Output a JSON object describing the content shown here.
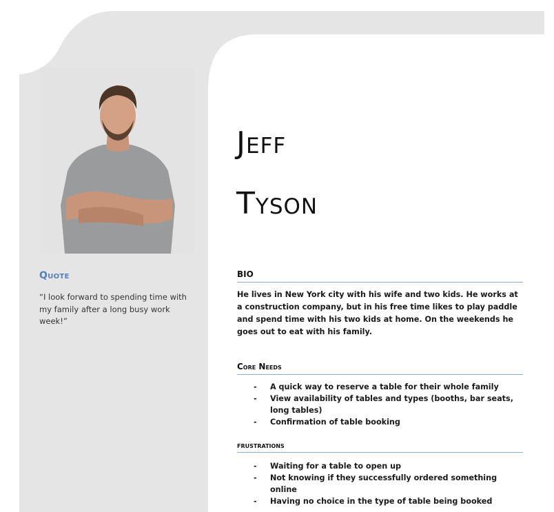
{
  "persona": {
    "first_name": "Jeff",
    "last_name": "Tyson"
  },
  "quote": {
    "heading": "Quote",
    "text": "“I look forward to spending time with my family after a long busy work week!”"
  },
  "bio": {
    "heading": "BIO",
    "text": "He lives in New York city with his wife and two kids. He works at a construction company, but in his free time likes to play paddle and spend time with his two kids at home. On the weekends he goes out to eat with his family."
  },
  "core_needs": {
    "heading": "Core Needs",
    "items": [
      "A quick way to reserve a table for their whole family",
      "View availability of tables and types  (booths, bar seats, long tables)",
      "Confirmation of table booking"
    ]
  },
  "frustrations": {
    "heading": "Frustrations",
    "items": [
      "Waiting for a table to open up",
      "Not knowing if they successfully ordered something online",
      "Having no choice in the type of table being booked"
    ]
  },
  "colors": {
    "accent": "#4f81bd",
    "rule": "#8eaacc",
    "panel": "#e6e5e6"
  }
}
